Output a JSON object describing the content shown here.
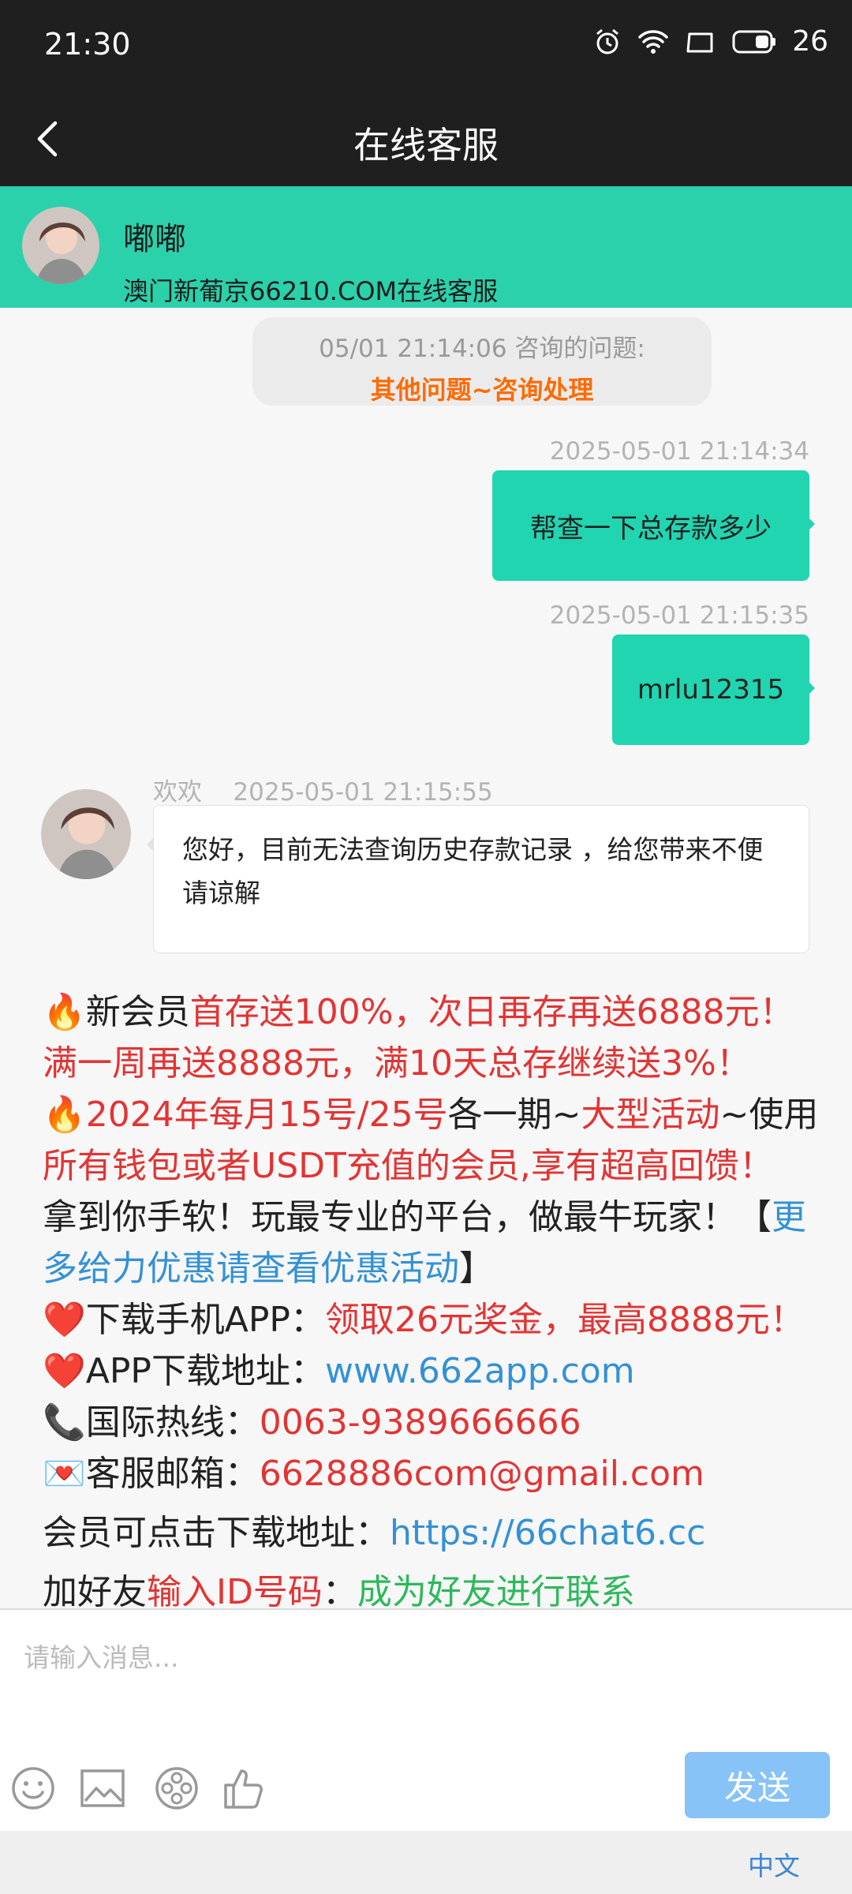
{
  "status_bar": {
    "time": "21:30",
    "battery": "26"
  },
  "nav": {
    "title": "在线客服"
  },
  "agent": {
    "name": "嘟嘟",
    "subtitle": "澳门新葡京66210.COM在线客服"
  },
  "inquiry": {
    "line1": "05/01 21:14:06 咨询的问题:",
    "line2": "其他问题~咨询处理"
  },
  "messages": {
    "out1": {
      "time": "2025-05-01 21:14:34",
      "text": "帮查一下总存款多少"
    },
    "out2": {
      "time": "2025-05-01 21:15:35",
      "text": "mrlu12315"
    },
    "in1": {
      "sender": "欢欢",
      "time": "2025-05-01 21:15:55",
      "text": "您好，目前无法查询历史存款记录 ，给您带来不便请谅解"
    }
  },
  "promo": {
    "l1a": "🔥新会员",
    "l1b": "首存送100%，次日再存再送6888元！满一周再送8888元，满10天总存继续送3%！",
    "l2a": "🔥",
    "l2b": "2024年每月15号/25号",
    "l2c": "各一期~",
    "l2d": "大型活动",
    "l2e": "~使用",
    "l2f": "所有钱包或者USDT充值的会员,享有超高回馈！",
    "l3a": "拿到你手软！玩最专业的平台，做最牛玩家！【",
    "l3b": "更多给力优惠请查看优惠活动",
    "l3c": "】",
    "l4a": "❤️下载手机APP：",
    "l4b": "领取26元奖金，最高8888元！",
    "l5a": "❤️APP下载地址：",
    "l5b": "www.662app.com",
    "l6a": "📞国际热线：",
    "l6b": "0063-9389666666",
    "l7a": "💌客服邮箱：",
    "l7b": "6628886com@gmail.com",
    "l8a": "会员可点击下载地址：",
    "l8b": "https://66chat6.cc",
    "l9a": "加好友",
    "l9b": "输入ID号码",
    "l9c": "：",
    "l9d": "成为好友进行联系"
  },
  "input": {
    "placeholder": "请输入消息..."
  },
  "send_label": "发送",
  "language": "中文",
  "colors": {
    "header_teal": "#2bd1ab",
    "bubble_teal": "#20d5b0",
    "send_blue": "#87c3f7",
    "accent_red": "#e23434",
    "link_blue": "#3391d6"
  }
}
